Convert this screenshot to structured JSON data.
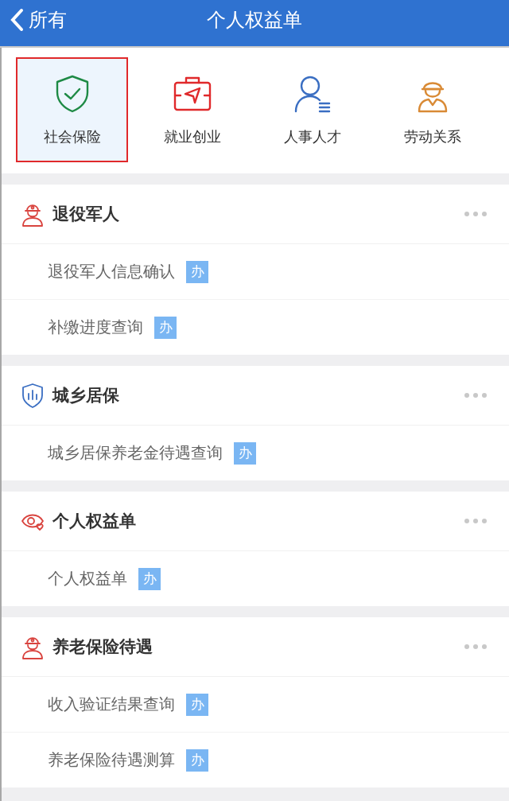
{
  "header": {
    "back_label": "所有",
    "title": "个人权益单"
  },
  "categories": [
    {
      "label": "社会保险",
      "kind": "shield",
      "selected": true
    },
    {
      "label": "就业创业",
      "kind": "briefcase",
      "selected": false
    },
    {
      "label": "人事人才",
      "kind": "person",
      "selected": false
    },
    {
      "label": "劳动关系",
      "kind": "worker",
      "selected": false
    }
  ],
  "sections": [
    {
      "title": "退役军人",
      "kind": "soldier",
      "items": [
        {
          "label": "退役军人信息确认",
          "badge": "办"
        },
        {
          "label": "补缴进度查询",
          "badge": "办"
        }
      ]
    },
    {
      "title": "城乡居保",
      "kind": "chart",
      "items": [
        {
          "label": "城乡居保养老金待遇查询",
          "badge": "办"
        }
      ]
    },
    {
      "title": "个人权益单",
      "kind": "eye",
      "items": [
        {
          "label": "个人权益单",
          "badge": "办"
        }
      ]
    },
    {
      "title": "养老保险待遇",
      "kind": "soldier",
      "items": [
        {
          "label": "收入验证结果查询",
          "badge": "办"
        },
        {
          "label": "养老保险待遇测算",
          "badge": "办"
        }
      ]
    }
  ]
}
